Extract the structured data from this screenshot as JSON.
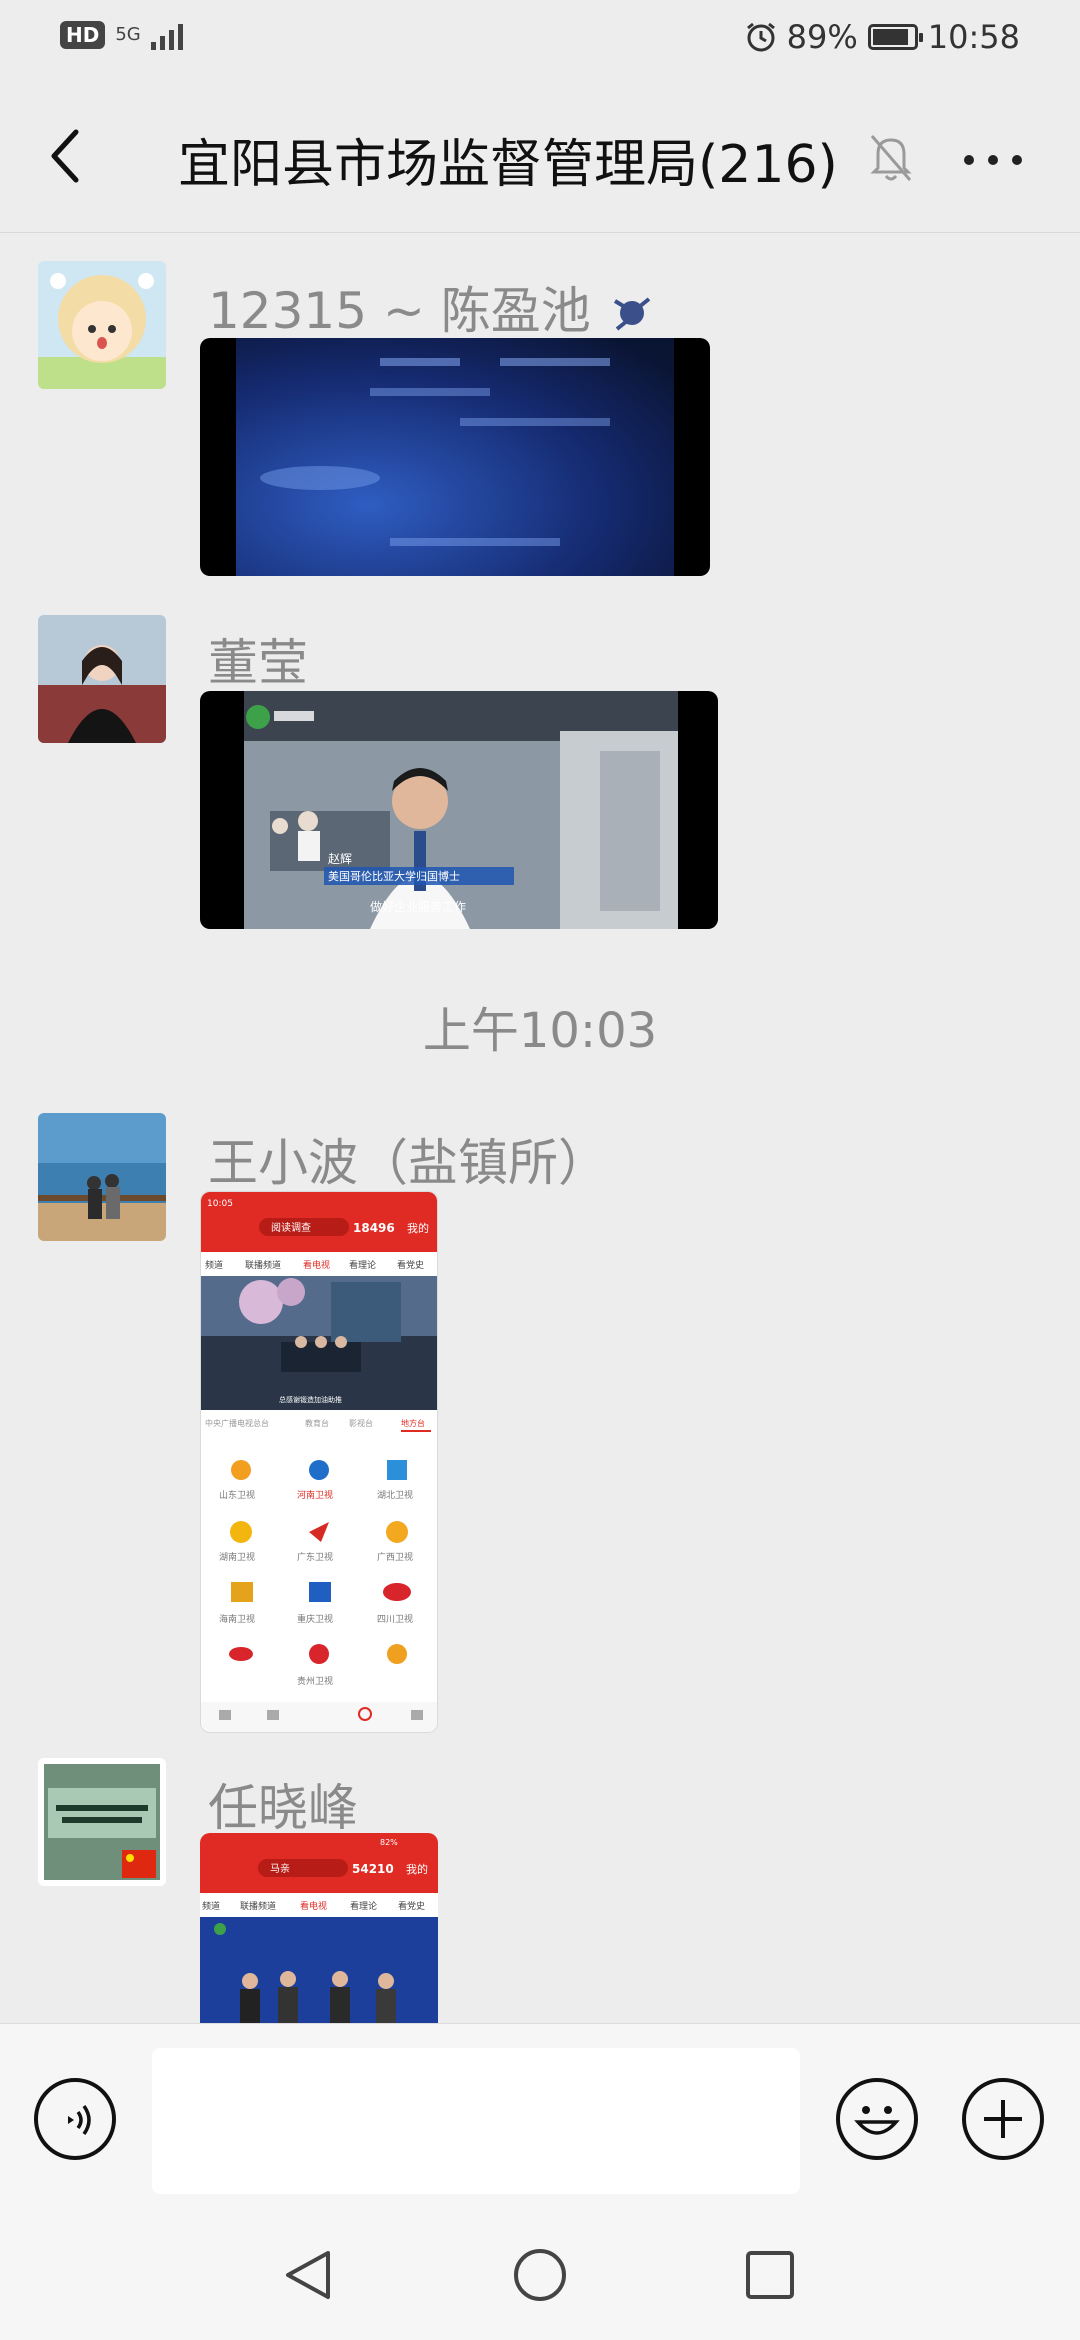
{
  "status_bar": {
    "hd_badge": "HD",
    "network": "5G",
    "battery_percent": "89%",
    "battery_level": 0.89,
    "time": "10:58",
    "icons": [
      "alarm-icon",
      "battery-icon",
      "signal-icon"
    ]
  },
  "header": {
    "title": "宜阳县市场监督管理局(216)",
    "icons": [
      "back-arrow-icon",
      "mute-bell-icon",
      "more-icon"
    ]
  },
  "messages": [
    {
      "sender": "12315 ~ 陈盈池",
      "type": "video"
    },
    {
      "sender": "董莹",
      "type": "video"
    },
    {
      "time_divider": "上午10:03"
    },
    {
      "sender": "王小波（盐镇所）",
      "type": "image"
    },
    {
      "sender": "任晓峰",
      "type": "image"
    }
  ],
  "media_text": {
    "video2_caption_name": "赵辉",
    "video2_caption_title": "美国哥伦比亚大学归国博士",
    "video2_subtitle": "做好企业服务工作",
    "shot1_time": "10:05",
    "shot1_search": "阅读调查",
    "shot1_count": "18496",
    "shot1_my": "我的",
    "shot1_tabs": [
      "频道",
      "联播频道",
      "看电视",
      "看理论",
      "看党史"
    ],
    "shot1_subtabs": [
      "中央广播电视总台",
      "教育台",
      "影视台",
      "地方台"
    ],
    "shot1_banner_caption": "总感谢锻造加油助推",
    "shot1_channels": [
      "山东卫视",
      "河南卫视",
      "湖北卫视",
      "湖南卫视",
      "广东卫视",
      "广西卫视",
      "海南卫视",
      "重庆卫视",
      "四川卫视",
      "",
      "贵州卫视",
      ""
    ],
    "shot2_search": "马亲",
    "shot2_count": "54210",
    "shot2_my": "我的",
    "shot2_tabs": [
      "频道",
      "联播频道",
      "看电视",
      "看理论",
      "看党史"
    ],
    "shot2_battery": "82%"
  },
  "input_bar": {
    "placeholder": "",
    "icons": [
      "voice-icon",
      "emoji-icon",
      "plus-icon"
    ]
  },
  "nav_bar": {
    "icons": [
      "nav-back-icon",
      "nav-home-icon",
      "nav-recents-icon"
    ]
  },
  "colors": {
    "background": "#ededed",
    "red_app": "#e02a24"
  }
}
